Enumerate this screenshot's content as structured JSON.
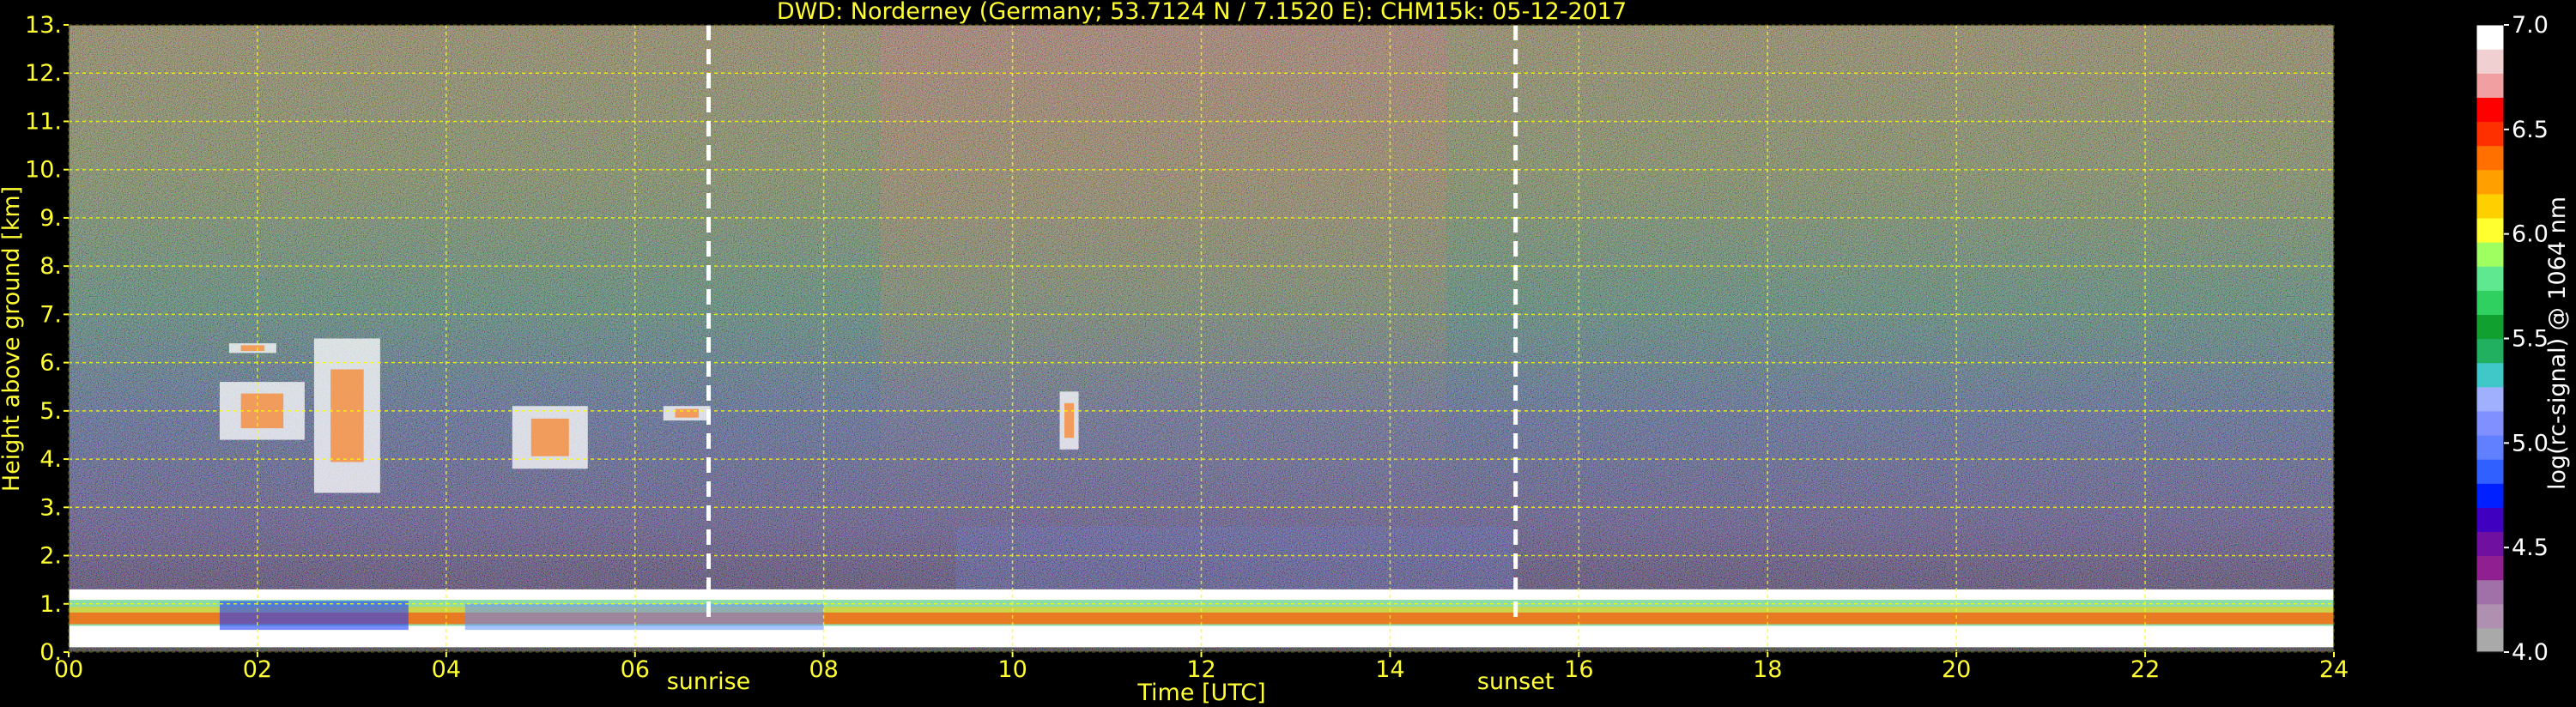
{
  "chart_data": {
    "type": "heatmap",
    "title": "DWD: Norderney (Germany; 53.7124 N / 7.1520 E):    CHM15k: 05-12-2017",
    "xlabel": "Time [UTC]",
    "ylabel": "Height above ground [km]",
    "xlim": [
      0,
      24
    ],
    "ylim": [
      0,
      13
    ],
    "x_ticks": [
      "00",
      "02",
      "04",
      "06",
      "08",
      "10",
      "12",
      "14",
      "16",
      "18",
      "20",
      "22",
      "24"
    ],
    "y_ticks": [
      "0.",
      "1.",
      "2.",
      "3.",
      "4.",
      "5.",
      "6.",
      "7.",
      "8.",
      "9.",
      "10.",
      "11.",
      "12.",
      "13."
    ],
    "grid": true,
    "grid_color": "#ffff00",
    "events": [
      {
        "label": "sunrise",
        "time_utc": 6.78
      },
      {
        "label": "sunset",
        "time_utc": 15.33
      }
    ],
    "colorbar": {
      "label": "log(rc-signal) @ 1064 nm",
      "range": [
        4.0,
        7.0
      ],
      "ticks": [
        "4.0",
        "4.5",
        "5.0",
        "5.5",
        "6.0",
        "6.5",
        "7.0"
      ],
      "colors": [
        "#a9a9a9",
        "#b090b0",
        "#a070a8",
        "#902090",
        "#7010a0",
        "#4000c0",
        "#0020ff",
        "#3060ff",
        "#6080ff",
        "#8090ff",
        "#a0b0ff",
        "#40c8c8",
        "#20b060",
        "#10a030",
        "#30d060",
        "#60e890",
        "#a0ff60",
        "#ffff30",
        "#ffd000",
        "#ffa000",
        "#ff7000",
        "#ff3000",
        "#ff0000",
        "#f0a0a0",
        "#f0d0d0",
        "#ffffff"
      ]
    },
    "cloud_layers": [
      {
        "kind": "boundary_layer",
        "start": 0.0,
        "end": 24.0,
        "base_km": 0.1,
        "top_km": 1.3
      },
      {
        "kind": "cloud",
        "start": 1.6,
        "end": 2.5,
        "base_km": 4.4,
        "top_km": 5.6
      },
      {
        "kind": "cloud",
        "start": 2.6,
        "end": 3.3,
        "base_km": 3.3,
        "top_km": 6.5
      },
      {
        "kind": "cloud",
        "start": 4.7,
        "end": 5.5,
        "base_km": 3.8,
        "top_km": 5.1
      },
      {
        "kind": "cloud",
        "start": 6.3,
        "end": 6.8,
        "base_km": 4.8,
        "top_km": 5.1
      },
      {
        "kind": "cloud",
        "start": 10.5,
        "end": 10.7,
        "base_km": 4.2,
        "top_km": 5.4
      },
      {
        "kind": "cloud",
        "start": 1.7,
        "end": 2.2,
        "base_km": 6.2,
        "top_km": 6.4
      }
    ]
  }
}
